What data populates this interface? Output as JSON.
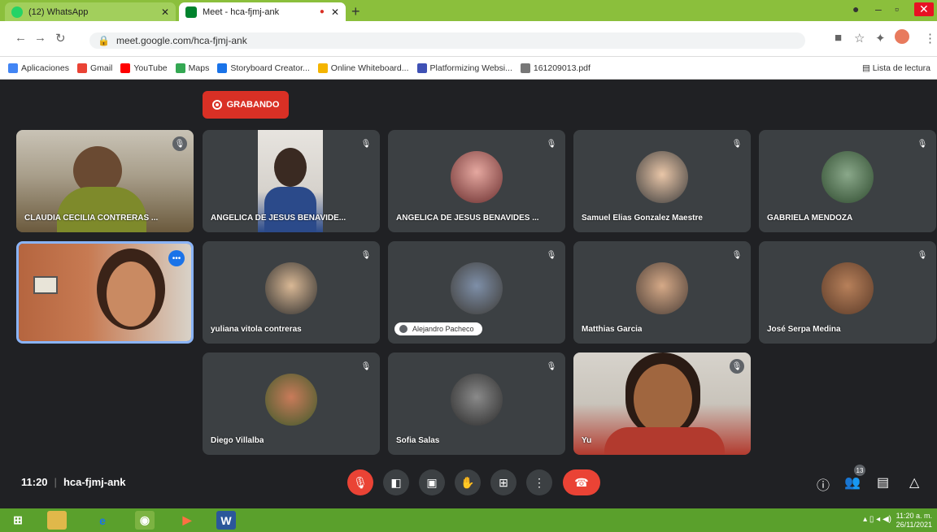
{
  "browser": {
    "tabs": [
      {
        "label": "(12) WhatsApp",
        "active": false
      },
      {
        "label": "Meet - hca-fjmj-ank",
        "active": true
      }
    ],
    "new_tab": "+",
    "url": "meet.google.com/hca-fjmj-ank",
    "bookmarks": [
      "Aplicaciones",
      "Gmail",
      "YouTube",
      "Maps",
      "Storyboard Creator...",
      "Online Whiteboard...",
      "Platformizing Websi...",
      "161209013.pdf"
    ],
    "reading_list": "Lista de lectura"
  },
  "meet": {
    "recording_label": "GRABANDO",
    "meeting_time": "11:20",
    "meeting_code": "hca-fjmj-ank",
    "participants": [
      {
        "name": "CLAUDIA CECILIA CONTRERAS ..."
      },
      {
        "name": "ANGELICA DE JESUS BENAVIDE..."
      },
      {
        "name": "ANGELICA DE JESUS BENAVIDES ..."
      },
      {
        "name": "Samuel Elias Gonzalez Maestre"
      },
      {
        "name": "GABRIELA MENDOZA"
      },
      {
        "name": ""
      },
      {
        "name": "yuliana vitola contreras"
      },
      {
        "name": "Alejandro Pacheco"
      },
      {
        "name": "Matthias Garcia"
      },
      {
        "name": "José Serpa Medina"
      },
      {
        "name": "Diego Villalba"
      },
      {
        "name": "Sofia Salas"
      },
      {
        "name": "Yu"
      }
    ],
    "people_count": "13"
  },
  "taskbar": {
    "time": "11:20 a. m.",
    "date": "26/11/2021"
  }
}
